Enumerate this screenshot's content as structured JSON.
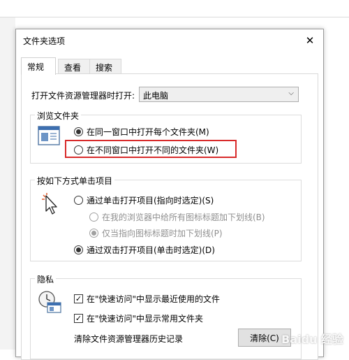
{
  "dialog": {
    "title": "文件夹选项",
    "close_glyph": "✕"
  },
  "tabs": [
    {
      "label": "常规"
    },
    {
      "label": "查看"
    },
    {
      "label": "搜索"
    }
  ],
  "open_explorer": {
    "label": "打开文件资源管理器时打开:",
    "value": "此电脑"
  },
  "browse_folders": {
    "title": "浏览文件夹",
    "options": [
      {
        "label": "在同一窗口中打开每个文件夹(M)",
        "checked": true
      },
      {
        "label": "在不同窗口中打开不同的文件夹(W)",
        "checked": false
      }
    ]
  },
  "click_items": {
    "title": "按如下方式单击项目",
    "single_click": "通过单击打开项目(指向时选定)(S)",
    "underline_all": "在我的浏览器中给所有图标标题加下划线(B)",
    "underline_hover": "仅当指向图标标题时加下划线(P)",
    "double_click": "通过双击打开项目(单击时选定)(D)"
  },
  "privacy": {
    "title": "隐私",
    "show_recent_files": "在\"快速访问\"中显示最近使用的文件",
    "show_frequent_folders": "在\"快速访问\"中显示常用文件夹",
    "clear_history_label": "清除文件资源管理器历史记录",
    "clear_button": "清除(C)"
  },
  "watermark": "Baidu 经验",
  "colors": {
    "highlight": "#d82a2a"
  },
  "icons": {
    "folder_window": "folder-window-icon",
    "cursor_click": "cursor-click-icon",
    "privacy_clock": "privacy-clock-icon"
  }
}
